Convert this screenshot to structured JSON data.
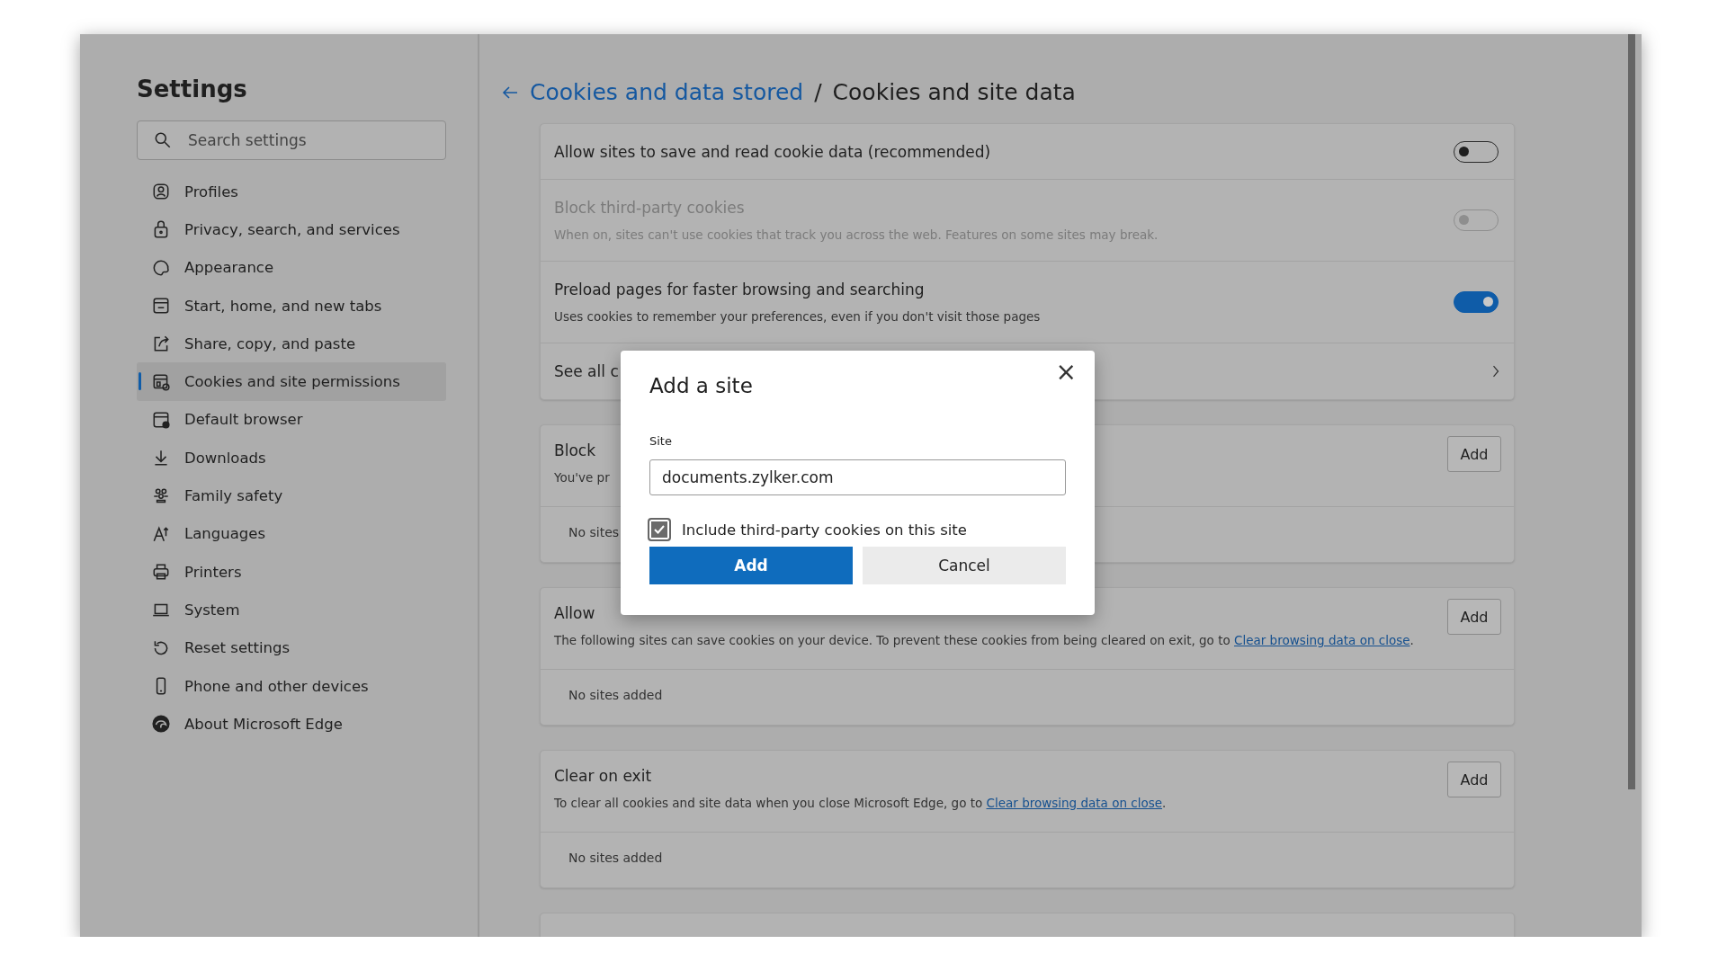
{
  "sidebar": {
    "title": "Settings",
    "search": {
      "placeholder": "Search settings"
    },
    "items": [
      {
        "label": "Profiles",
        "selected": false
      },
      {
        "label": "Privacy, search, and services",
        "selected": false
      },
      {
        "label": "Appearance",
        "selected": false
      },
      {
        "label": "Start, home, and new tabs",
        "selected": false
      },
      {
        "label": "Share, copy, and paste",
        "selected": false
      },
      {
        "label": "Cookies and site permissions",
        "selected": true
      },
      {
        "label": "Default browser",
        "selected": false
      },
      {
        "label": "Downloads",
        "selected": false
      },
      {
        "label": "Family safety",
        "selected": false
      },
      {
        "label": "Languages",
        "selected": false
      },
      {
        "label": "Printers",
        "selected": false
      },
      {
        "label": "System",
        "selected": false
      },
      {
        "label": "Reset settings",
        "selected": false
      },
      {
        "label": "Phone and other devices",
        "selected": false
      },
      {
        "label": "About Microsoft Edge",
        "selected": false
      }
    ]
  },
  "content": {
    "breadcrumb": {
      "parent": "Cookies and data stored",
      "separator": "/",
      "current": "Cookies and site data"
    },
    "settings": [
      {
        "kind": "toggle",
        "title": "Allow sites to save and read cookie data (recommended)",
        "on": false,
        "disabled": false
      },
      {
        "kind": "toggle",
        "title": "Block third-party cookies",
        "description": "When on, sites can't use cookies that track you across the web. Features on some sites may break.",
        "on": false,
        "disabled": true
      },
      {
        "kind": "toggle",
        "title": "Preload pages for faster browsing and searching",
        "description": "Uses cookies to remember your preferences, even if you don't visit those pages",
        "on": true,
        "disabled": false
      },
      {
        "kind": "link",
        "title": "See all c"
      }
    ],
    "sections": [
      {
        "title": "Block",
        "description": "You've pr",
        "button": "Add",
        "empty_text": "No sites"
      },
      {
        "title": "Allow",
        "description": "The following sites can save cookies on your device. To prevent these cookies from being cleared on exit, go to",
        "link": "Clear browsing data on close",
        "end": ".",
        "button": "Add",
        "empty_text": "No sites added"
      },
      {
        "title": "Clear on exit",
        "description": "To clear all cookies and site data when you close Microsoft Edge, go to",
        "link": "Clear browsing data on close",
        "end": ".",
        "button": "Add",
        "empty_text": "No sites added"
      }
    ]
  },
  "dialog": {
    "title": "Add a site",
    "close": "×",
    "field_label": "Site",
    "value": "documents.zylker.com",
    "checkbox": {
      "label": "Include third-party cookies on this site",
      "checked": true
    },
    "buttons": [
      {
        "label": "Add",
        "kind": "primary"
      },
      {
        "label": "Cancel",
        "kind": "secondary"
      }
    ]
  }
}
